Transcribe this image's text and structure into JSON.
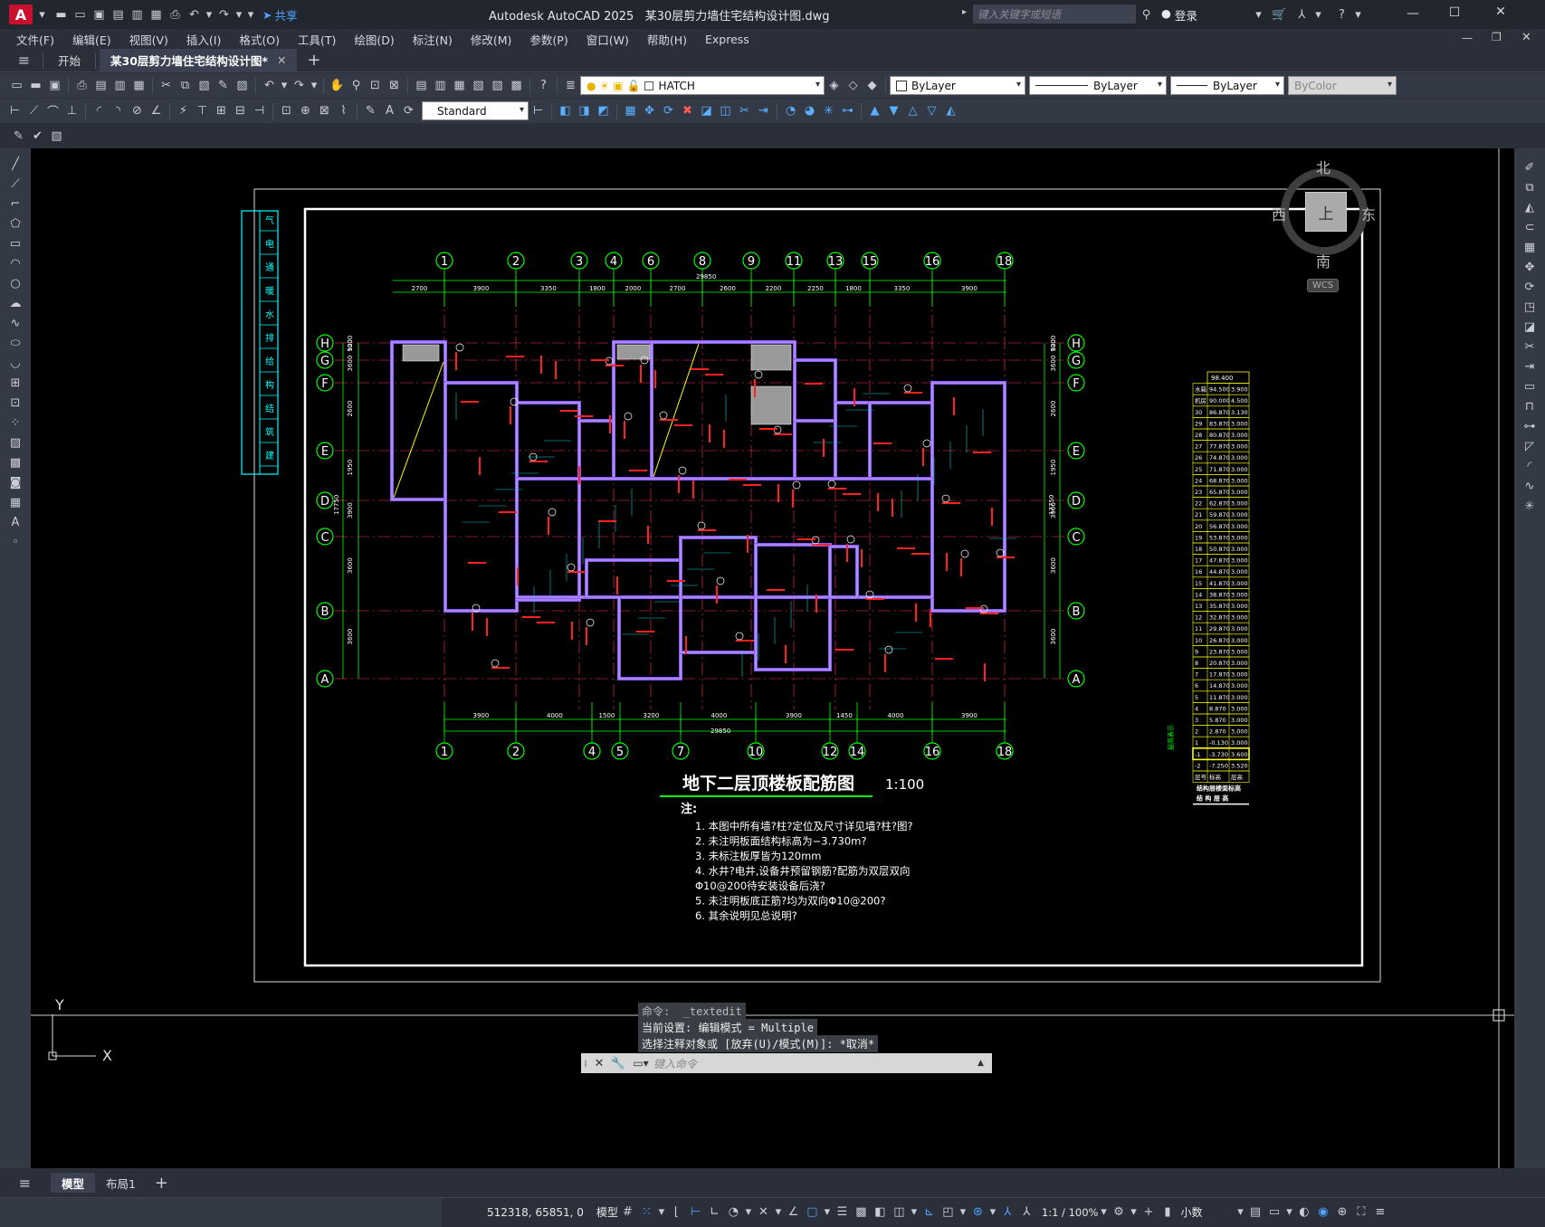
{
  "titlebar": {
    "app_logo": "A",
    "share_label": "共享",
    "title": "Autodesk AutoCAD 2025",
    "filename": "某30层剪力墙住宅结构设计图.dwg",
    "search_placeholder": "键入关键字或短语",
    "login_label": "登录"
  },
  "menu": [
    "文件(F)",
    "编辑(E)",
    "视图(V)",
    "插入(I)",
    "格式(O)",
    "工具(T)",
    "绘图(D)",
    "标注(N)",
    "修改(M)",
    "参数(P)",
    "窗口(W)",
    "帮助(H)",
    "Express"
  ],
  "tabs": {
    "start": "开始",
    "doc": "某30层剪力墙住宅结构设计图*"
  },
  "toolbar": {
    "layer_name": "HATCH",
    "color": "ByLayer",
    "linetype": "ByLayer",
    "lineweight": "ByLayer",
    "plotstyle": "ByColor",
    "textstyle": "Standard"
  },
  "viewcube": {
    "north": "北",
    "south": "南",
    "east": "东",
    "west": "西",
    "face": "上",
    "wcs": "WCS"
  },
  "ucs": {
    "x": "X",
    "y": "Y"
  },
  "drawing": {
    "title": "地下二层顶楼板配筋图",
    "scale": "1:100",
    "notes_heading": "注:",
    "notes": [
      "1.  本图中所有墙?柱?定位及尺寸详见墙?柱?图?",
      "2.  未注明板面结构标高为−3.730m?",
      "3.  未标注板厚皆为120mm",
      "4.  水井?电井,设备井预留钢筋?配筋为双层双向",
      "    Φ10@200待安装设备后浇?",
      "5.  未注明板底正筋?均为双向Φ10@200?",
      "6.  其余说明见总说明?"
    ],
    "top_axes": [
      "1",
      "2",
      "3",
      "4",
      "6",
      "8",
      "9",
      "11",
      "13",
      "15",
      "16",
      "18"
    ],
    "bottom_axes": [
      "1",
      "2",
      "4",
      "5",
      "7",
      "10",
      "12",
      "14",
      "16",
      "18"
    ],
    "row_axes": [
      "H",
      "G",
      "F",
      "E",
      "D",
      "C",
      "B",
      "A"
    ],
    "top_dims": [
      "2700",
      "3900",
      "3350",
      "1800",
      "2000",
      "2700",
      "2600",
      "2200",
      "2250",
      "1800",
      "3350",
      "3900"
    ],
    "top_total": "29850",
    "bottom_dims": [
      "3900",
      "4000",
      "1500",
      "3200",
      "4000",
      "3900",
      "1450",
      "4000",
      "3900"
    ],
    "bottom_total": "29850",
    "side_dims": [
      "900",
      "1200",
      "3600",
      "2600",
      "1950",
      "3900",
      "3600",
      "3600"
    ],
    "side_total": "17750",
    "stamp_chars": [
      "建",
      "筑",
      "结",
      "构",
      "给",
      "排",
      "水",
      "暖",
      "通",
      "电",
      "气"
    ],
    "floor_table": {
      "top": "98.400",
      "rows": [
        [
          "水箱",
          "94.500",
          "3.900"
        ],
        [
          "机房",
          "90.000",
          "4.500"
        ],
        [
          "30",
          "86.870",
          "3.130"
        ],
        [
          "29",
          "83.870",
          "3.000"
        ],
        [
          "28",
          "80.870",
          "3.000"
        ],
        [
          "27",
          "77.870",
          "3.000"
        ],
        [
          "26",
          "74.870",
          "3.000"
        ],
        [
          "25",
          "71.870",
          "3.000"
        ],
        [
          "24",
          "68.870",
          "3.000"
        ],
        [
          "23",
          "65.870",
          "3.000"
        ],
        [
          "22",
          "62.870",
          "3.000"
        ],
        [
          "21",
          "59.870",
          "3.000"
        ],
        [
          "20",
          "56.870",
          "3.000"
        ],
        [
          "19",
          "53.870",
          "3.000"
        ],
        [
          "18",
          "50.870",
          "3.000"
        ],
        [
          "17",
          "47.870",
          "3.000"
        ],
        [
          "16",
          "44.870",
          "3.000"
        ],
        [
          "15",
          "41.870",
          "3.000"
        ],
        [
          "14",
          "38.870",
          "3.000"
        ],
        [
          "13",
          "35.870",
          "3.000"
        ],
        [
          "12",
          "32.870",
          "3.000"
        ],
        [
          "11",
          "29.870",
          "3.000"
        ],
        [
          "10",
          "26.870",
          "3.000"
        ],
        [
          "9",
          "23.870",
          "3.000"
        ],
        [
          "8",
          "20.870",
          "3.000"
        ],
        [
          "7",
          "17.870",
          "3.000"
        ],
        [
          "6",
          "14.870",
          "3.000"
        ],
        [
          "5",
          "11.870",
          "3.000"
        ],
        [
          "4",
          "8.870",
          "3.000"
        ],
        [
          "3",
          "5.870",
          "3.000"
        ],
        [
          "2",
          "2.870",
          "3.000"
        ],
        [
          "1",
          "-0.130",
          "3.000"
        ],
        [
          "-1",
          "-3.730",
          "3.600"
        ],
        [
          "-2",
          "-7.250",
          "3.520"
        ],
        [
          "层号",
          "标高",
          "层高"
        ]
      ],
      "caption": "结构层楼面标高",
      "caption2": "结 构 层 高",
      "side_label": "层高表示"
    }
  },
  "command": {
    "line1": "命令:  _textedit",
    "line2": "当前设置: 编辑模式 = Multiple",
    "line3": "选择注释对象或 [放弃(U)/模式(M)]: *取消*",
    "placeholder": "键入命令"
  },
  "layout_tabs": {
    "model": "模型",
    "layout1": "布局1"
  },
  "status": {
    "coords": "512318, 65851, 0",
    "mode": "模型",
    "scale": "1:1 / 100%",
    "units": "小数"
  }
}
